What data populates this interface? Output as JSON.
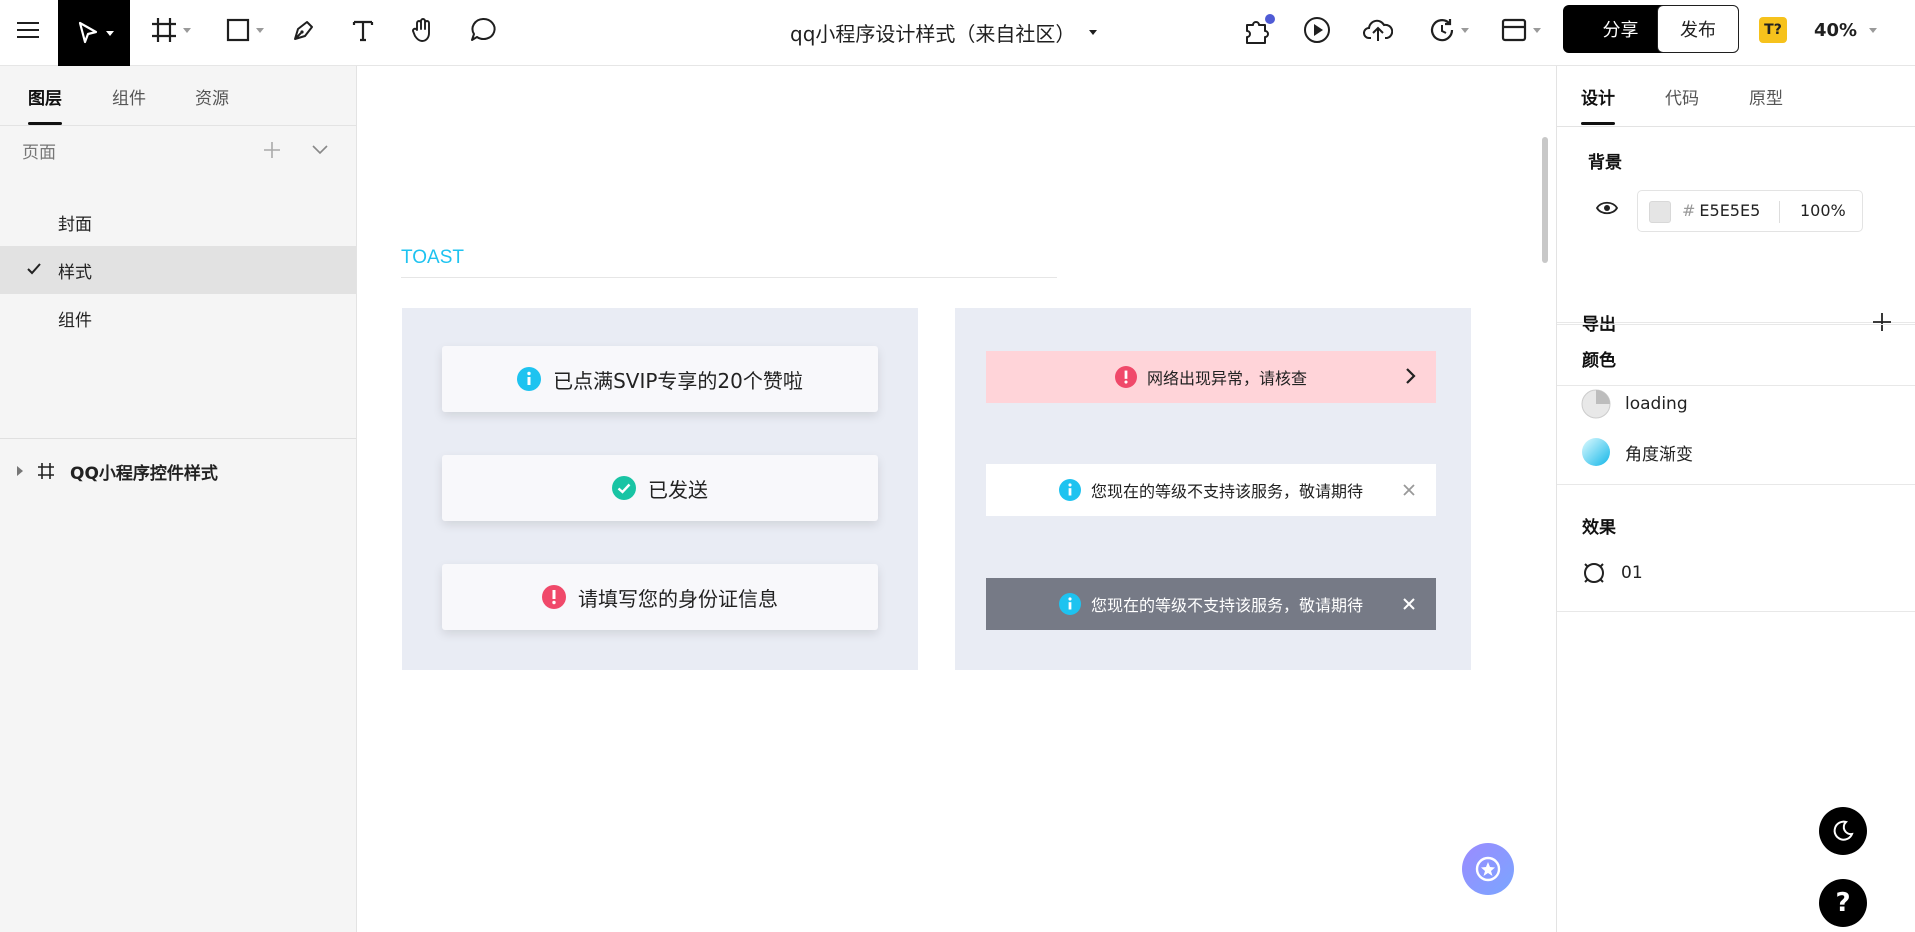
{
  "document": {
    "title": "qq小程序设计样式（来自社区）"
  },
  "toolbar": {
    "share_label": "分享",
    "publish_label": "发布",
    "badge_label": "T?",
    "zoom": "40%"
  },
  "left_panel": {
    "tabs": [
      {
        "label": "图层"
      },
      {
        "label": "组件"
      },
      {
        "label": "资源"
      }
    ],
    "pages_label": "页面",
    "pages": [
      {
        "label": "封面"
      },
      {
        "label": "样式"
      },
      {
        "label": "组件"
      }
    ],
    "layers": [
      {
        "label": "QQ小程序控件样式"
      }
    ]
  },
  "canvas": {
    "section_heading": "TOAST",
    "toasts": [
      {
        "text": "已点满SVIP专享的20个赞啦",
        "icon": "info-icon"
      },
      {
        "text": "已发送",
        "icon": "success-icon"
      },
      {
        "text": "请填写您的身份证信息",
        "icon": "error-icon"
      }
    ],
    "banners": [
      {
        "text": "网络出现异常，请核查",
        "icon": "error-icon",
        "tail": "chevron-right-icon"
      },
      {
        "text": "您现在的等级不支持该服务，敬请期待",
        "icon": "info-icon",
        "tail": "close-icon"
      },
      {
        "text": "您现在的等级不支持该服务，敬请期待",
        "icon": "info-icon",
        "tail": "close-icon"
      }
    ]
  },
  "right_panel": {
    "tabs": [
      {
        "label": "设计"
      },
      {
        "label": "代码"
      },
      {
        "label": "原型"
      }
    ],
    "background": {
      "title": "背景",
      "hash": "#",
      "hex": "E5E5E5",
      "opacity": "100%"
    },
    "export": {
      "title": "导出"
    },
    "colors": {
      "title": "颜色",
      "items": [
        {
          "label": "loading"
        },
        {
          "label": "角度渐变"
        }
      ]
    },
    "effects": {
      "title": "效果",
      "items": [
        {
          "label": "01"
        }
      ]
    }
  },
  "colors": {
    "accent_cyan": "#1EC3F0",
    "success_green": "#19C4A4",
    "error_pink": "#F0496A",
    "frame_bg": "#E9ECF4",
    "banner_error_bg": "#FFD4D9",
    "banner_dark_bg": "#767A86"
  }
}
